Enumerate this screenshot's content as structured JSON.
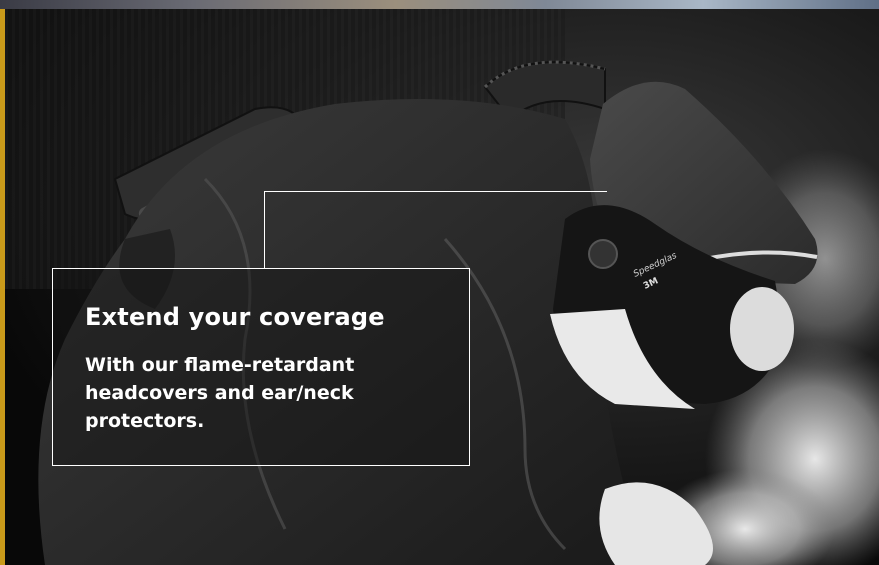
{
  "hero": {
    "image_icon": "welder-with-powered-respirator-helmet",
    "helmet_brand": "3M",
    "helmet_product": "Speedglas",
    "accent_color": "#c99a1a",
    "callout": {
      "title": "Extend your coverage",
      "body": "With our flame-retardant headcovers and ear/neck protectors."
    }
  }
}
